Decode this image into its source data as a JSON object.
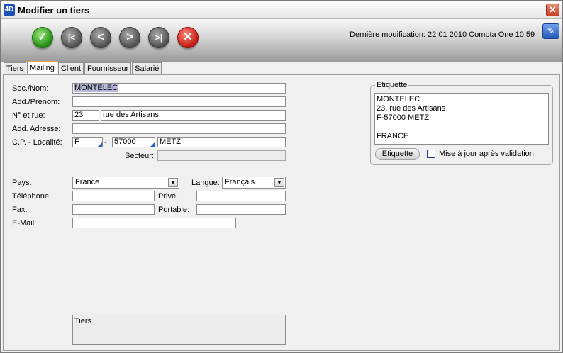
{
  "window": {
    "title": "Modifier un tiers",
    "app_icon_text": "4D",
    "close_glyph": "✕"
  },
  "toolbar": {
    "validate_glyph": "✓",
    "first_glyph": "|<",
    "prev_glyph": "<",
    "next_glyph": ">",
    "last_glyph": ">|",
    "cancel_glyph": "✕",
    "last_modification": "Dernière modification: 22 01 2010 Compta One 10:59",
    "edit_glyph": "✎"
  },
  "tabs": [
    {
      "label": "Tiers",
      "active": false
    },
    {
      "label": "Mailing",
      "active": true
    },
    {
      "label": "Client",
      "active": false
    },
    {
      "label": "Fournisseur",
      "active": false
    },
    {
      "label": "Salarié",
      "active": false
    }
  ],
  "form": {
    "soc_nom_label": "Soc./Nom:",
    "soc_nom_value": "MONTELEC",
    "add_prenom_label": "Add./Prénom:",
    "add_prenom_value": "",
    "num_rue_label": "N° et rue:",
    "num_value": "23",
    "rue_value": "rue des Artisans",
    "add_adresse_label": "Add. Adresse:",
    "add_adresse_value": "",
    "cp_localite_label": "C.P. - Localité:",
    "country_code_value": "F",
    "separator": "-",
    "cp_value": "57000",
    "localite_value": "METZ",
    "secteur_label": "Secteur:",
    "secteur_value": "",
    "pays_label": "Pays:",
    "pays_value": "France",
    "langue_label": "Langue:",
    "langue_value": "Français",
    "telephone_label": "Téléphone:",
    "telephone_value": "",
    "prive_label": "Privé:",
    "prive_value": "",
    "fax_label": "Fax:",
    "fax_value": "",
    "portable_label": "Portable:",
    "portable_value": "",
    "email_label": "E-Mail:",
    "email_value": "",
    "notes_value": "Tiers"
  },
  "etiquette": {
    "group_title": "Etiquette",
    "lines": [
      "MONTELEC",
      "23, rue des Artisans",
      "F-57000 METZ",
      "",
      "FRANCE"
    ],
    "button_label": "Etiquette",
    "checkbox_label": "Mise à jour après validation",
    "checkbox_checked": false
  },
  "colors": {
    "accent_tab": "#f2a53a",
    "validate_green": "#1f8c13",
    "cancel_red": "#c31a10",
    "selection": "#b8b8d8"
  }
}
